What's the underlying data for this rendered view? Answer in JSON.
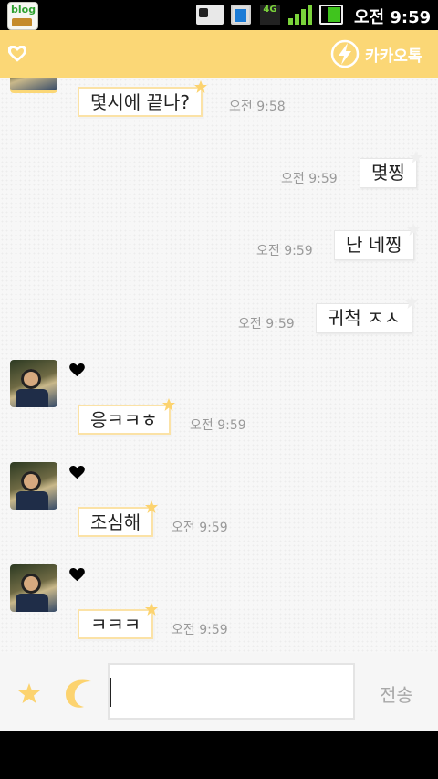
{
  "statusbar": {
    "blog_label": "blog",
    "network_type": "4G",
    "time": "오전 9:59"
  },
  "appbar": {
    "brand": "카카오톡",
    "accent_color": "#fbd776"
  },
  "messages": [
    {
      "side": "in",
      "text": "몇시에 끝나?",
      "time": "오전 9:58"
    },
    {
      "side": "out",
      "text": "몇찡",
      "time": "오전 9:59"
    },
    {
      "side": "out",
      "text": "난 네찡",
      "time": "오전 9:59"
    },
    {
      "side": "out",
      "text": "귀척 ㅈㅅ",
      "time": "오전 9:59"
    },
    {
      "side": "in",
      "text": "응ㅋㅋㅎ",
      "time": "오전 9:59"
    },
    {
      "side": "in",
      "text": "조심해",
      "time": "오전 9:59"
    },
    {
      "side": "in",
      "text": "ㅋㅋㅋ",
      "time": "오전 9:59"
    }
  ],
  "composer": {
    "input_value": "",
    "send_label": "전송"
  }
}
